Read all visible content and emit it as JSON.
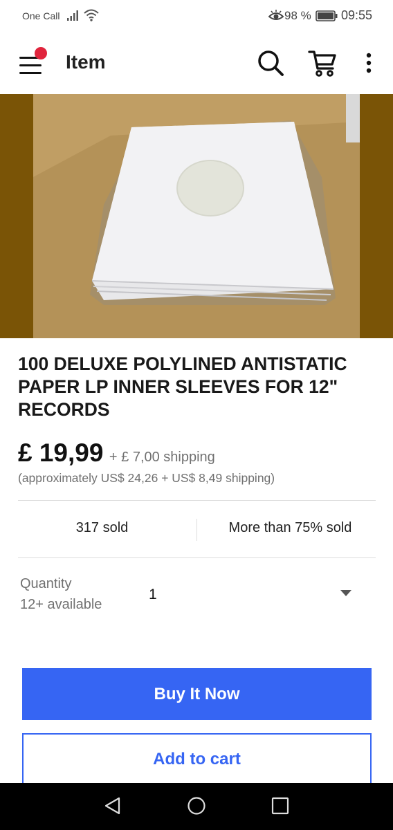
{
  "status_bar": {
    "carrier": "One Call",
    "battery_percent": "98 %",
    "time": "09:55",
    "icons": [
      "signal-icon",
      "wifi-icon",
      "eye-comfort-icon",
      "battery-icon"
    ]
  },
  "app_bar": {
    "title": "Item",
    "icons": [
      "menu-icon",
      "search-icon",
      "cart-icon",
      "more-vertical-icon"
    ],
    "notification_dot_color": "#e0243c"
  },
  "product": {
    "title": "100 DELUXE POLYLINED ANTISTATIC PAPER LP INNER SLEEVES FOR 12\" RECORDS",
    "price": "£ 19,99",
    "shipping": "+ £ 7,00 shipping",
    "approx_price": "(approximately US$ 24,26 + US$ 8,49 shipping)",
    "sold_count": "317 sold",
    "sold_percent": "More than 75% sold"
  },
  "quantity": {
    "label": "Quantity",
    "available": "12+ available",
    "value": "1"
  },
  "actions": {
    "buy_now": "Buy It Now",
    "add_to_cart": "Add to cart",
    "primary_color": "#3665f3"
  },
  "nav_bar": {
    "icons": [
      "back-icon",
      "home-icon",
      "recent-apps-icon"
    ]
  }
}
